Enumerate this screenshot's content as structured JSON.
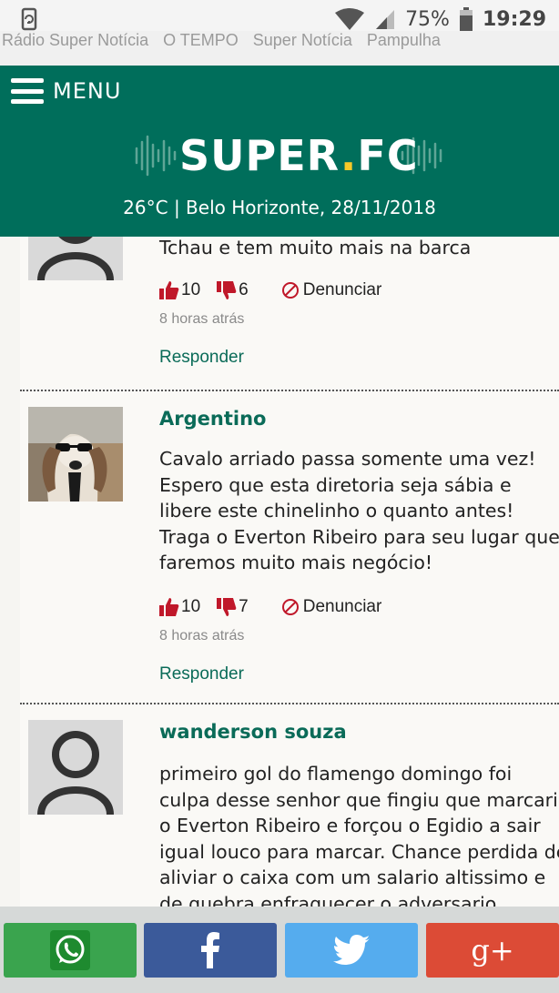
{
  "status_bar": {
    "battery": "75%",
    "time": "19:29",
    "icons": [
      "rotation-lock-icon",
      "wifi-icon",
      "signal-icon",
      "battery-icon"
    ]
  },
  "partners": {
    "links": [
      "Rádio Super Notícia",
      "O TEMPO",
      "Super Notícia",
      "Pampulha"
    ]
  },
  "header": {
    "menu_label": "MENU",
    "logo_text_1": "SUPER",
    "logo_dot": ".",
    "logo_text_2": "FC",
    "weather": "26°C | Belo Horizonte, 28/11/2018",
    "colors": {
      "background": "#006e5b",
      "logo_dot": "#f7c928"
    }
  },
  "comments": [
    {
      "author": "",
      "lines": [
        "Tchau e tem muito mais na barca"
      ],
      "likes": "10",
      "dislikes": "6",
      "report_label": "Denunciar",
      "time": "8 horas atrás",
      "reply_label": "Responder"
    },
    {
      "author": "Argentino",
      "lines": [
        "Cavalo arriado passa somente uma vez!",
        "Espero que esta diretoria seja sábia e",
        "libere este chinelinho o quanto antes!",
        "Traga o Everton Ribeiro para seu lugar que",
        "faremos muito mais negócio!"
      ],
      "likes": "10",
      "dislikes": "7",
      "report_label": "Denunciar",
      "time": "8 horas atrás",
      "reply_label": "Responder"
    },
    {
      "author": "wanderson souza",
      "lines": [
        "primeiro gol do flamengo domingo foi",
        "culpa desse senhor que fingiu que marcaria",
        "o Everton Ribeiro e forçou o Egidio a sair",
        "igual louco para marcar. Chance perdida de",
        "aliviar o caixa com um salario altissimo e",
        "de quebra enfraquecer o adversario"
      ]
    }
  ],
  "share_bar": {
    "buttons": [
      "whatsapp-icon",
      "facebook-icon",
      "twitter-icon",
      "google-plus-icon"
    ],
    "colors": {
      "whatsapp": "#3aa44e",
      "facebook": "#3b5a9a",
      "twitter": "#55acee",
      "google": "#dc4b36"
    },
    "google_label": "g+"
  }
}
